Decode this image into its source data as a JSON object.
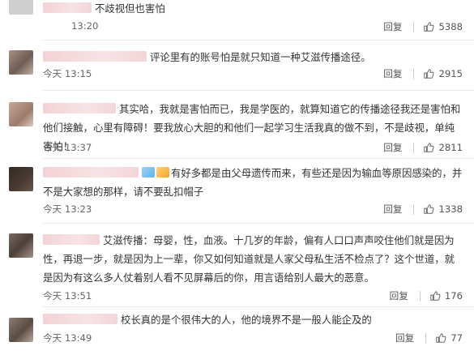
{
  "comments": [
    {
      "text": "不歧视但也害怕",
      "time": "13:20",
      "reply": "回复",
      "likes": "5388"
    },
    {
      "text": "评论里有的账号怕是就只知道一种艾滋传播途径。",
      "time": "今天 13:15",
      "reply": "回复",
      "likes": "2915"
    },
    {
      "text": "其实哈，我就是害怕而已，我是学医的，就算知道它的传播途径我还是害怕和他们接触，心里有障碍！要我放心大胆的和他们一起学习生活我真的做不到，不是歧视，单纯害怕！",
      "time": "今天 13:37",
      "reply": "回复",
      "likes": "2811"
    },
    {
      "text": "有好多都是由父母遗传而来，有些还是因为输血等原因感染的，并不是大家想的那样，请不要乱扣帽子",
      "time": "今天 13:23",
      "reply": "回复",
      "likes": "1338"
    },
    {
      "text": "艾滋传播：母婴，性，血液。十几岁的年龄，偏有人口口声声咬住他们就是因为性，再退一步，就是因为上一辈，你又如何知道就是人家父母私生活不检点了？这个世道，就是因为有这么多人仗着别人看不见屏幕后的你，用言语给别人最大的恶意。",
      "time": "今天 13:51",
      "reply": "回复",
      "likes": "176"
    },
    {
      "text": "校长真的是个很伟大的人，他的境界不是一般人能企及的",
      "time": "今天 13:49",
      "reply": "回复",
      "likes": "77"
    }
  ]
}
